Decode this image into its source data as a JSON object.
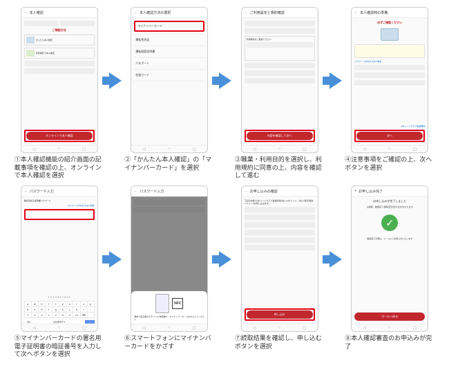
{
  "steps": [
    {
      "head": "本人確認",
      "title": "ご確認方法",
      "opt1": "かんたん本人確認",
      "opt2": "写真撮影で本人確認",
      "btn": "オンラインで本人確認",
      "cap": "①本人確認機能の紹介画面の記載事項を確認の上、オンラインで本人確認を選択"
    },
    {
      "head": "本人確認方法の選択",
      "item1": "マイナンバーカード",
      "item2": "運転免許証",
      "item3": "運転経歴証明書",
      "item4": "パスポート",
      "item5": "在留カード",
      "cap": "②「かんたん本人確認」の「マイナンバーカード」を選択"
    },
    {
      "head": "ご利用設定と規約確認",
      "sec": "利用規約をご確認ください",
      "btn": "内容を確認して次へ",
      "cap": "③職業・利用目的を選択し、利用規約に同意の上、内容を確認して進む"
    },
    {
      "head": "本人確認時の準備",
      "warn": "必ずご確認ください",
      "note": "パスワードがわからない場合",
      "btn": "次へ",
      "foot": "dポイントクラブ会員規約",
      "cap": "④注意事項をご確認の上、次へボタンを選択"
    },
    {
      "head": "パスワード入力",
      "label": "署名用電子証明書パスワード",
      "link": "パスワードがわからない場合",
      "cap": "⑤マイナンバーカードの署名用電子証明書の暗証番号を入力して次へボタンを選択"
    },
    {
      "head": "パスワード入力",
      "modal": "端末で読み取れるモバイル非接触IC…マイナンバーカードをかざしてください",
      "cap": "⑥スマートフォンにマイナンバーカードをかざす"
    },
    {
      "head": "お申し込みの確認",
      "desc": "下記の内容でdポイントクラブ会員情報(d払い/dポイント、d払い残高(現金バリュー))を申し込みます。",
      "btn": "申し込む",
      "cap": "⑦読取結果を確認し、申し込むボタンを選択"
    },
    {
      "head": "お申し込み完了",
      "msg1": "お申し込みが完了しました",
      "msg2": "お客様、確認完了(即時/翌日/翌々日)がかかります",
      "msg3": "確認完了の際は、メールにてお知らせいたします",
      "btn": "ホームへ戻る",
      "cap": "⑧本人確認審査のお申込みが完了"
    }
  ],
  "nfc": "NFC"
}
